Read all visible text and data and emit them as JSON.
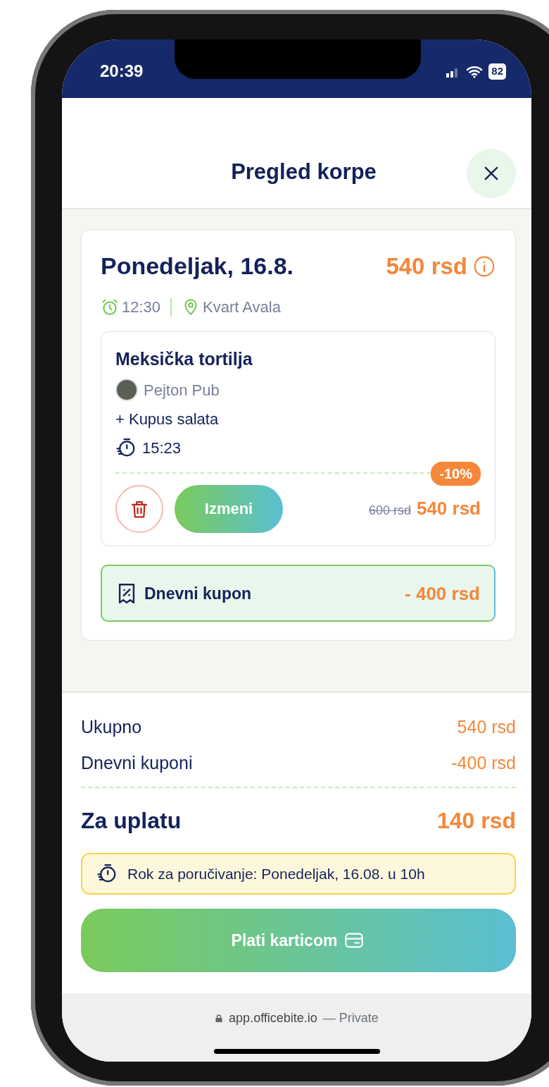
{
  "status_bar": {
    "time": "20:39",
    "battery": "82"
  },
  "header": {
    "title": "Pregled korpe"
  },
  "day": {
    "date": "Ponedeljak, 16.8.",
    "total": "540 rsd",
    "time": "12:30",
    "location": "Kvart Avala",
    "items": [
      {
        "name": "Meksička tortilja",
        "restaurant": "Pejton Pub",
        "addon": "+ Kupus salata",
        "prep_time": "15:23",
        "discount": "-10%",
        "old_price": "600 rsd",
        "price": "540 rsd",
        "edit_button": "Izmeni"
      }
    ],
    "coupon": {
      "label": "Dnevni kupon",
      "amount": "- 400 rsd"
    }
  },
  "summary": {
    "rows": [
      {
        "label": "Ukupno",
        "value": "540 rsd"
      },
      {
        "label": "Dnevni kuponi",
        "value": "-400 rsd"
      }
    ],
    "total": {
      "label": "Za uplatu",
      "value": "140 rsd"
    },
    "deadline": "Rok za poručivanje: Ponedeljak, 16.08. u 10h",
    "pay_button": "Plati karticom"
  },
  "browser": {
    "url": "app.officebite.io",
    "suffix": "— Private"
  }
}
